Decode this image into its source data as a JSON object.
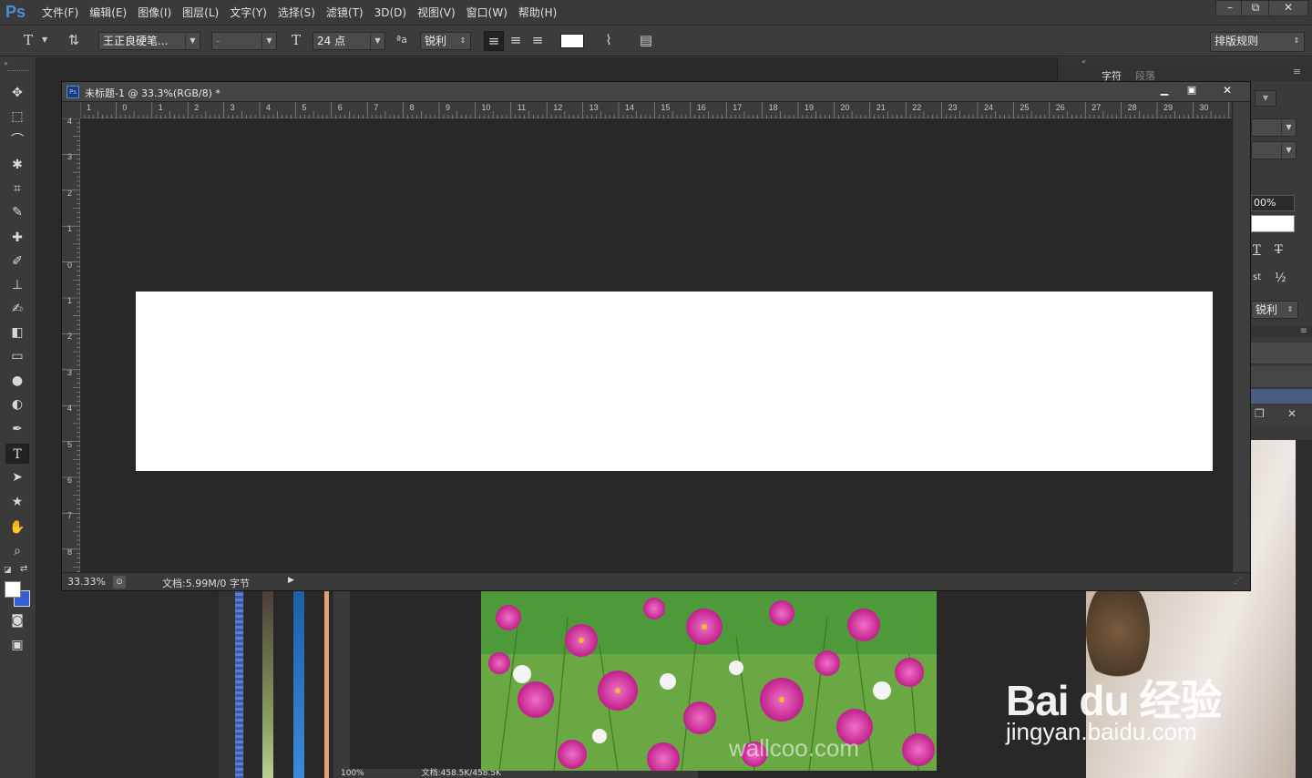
{
  "app": {
    "logo": "Ps"
  },
  "menu": [
    "文件(F)",
    "编辑(E)",
    "图像(I)",
    "图层(L)",
    "文字(Y)",
    "选择(S)",
    "滤镜(T)",
    "3D(D)",
    "视图(V)",
    "窗口(W)",
    "帮助(H)"
  ],
  "window_controls": {
    "minimize": "–",
    "restore": "⧉",
    "close": "✕"
  },
  "options_bar": {
    "tool_icon": "T",
    "font_family": "王正良硬笔...",
    "font_style": "-",
    "font_size": "24 点",
    "aa_label": "ªa",
    "antialias": "锐利",
    "color_swatch": "#ffffff",
    "workspace": "排版规则"
  },
  "right_panel": {
    "tabs": [
      "字符",
      "段落"
    ],
    "scale_value": "00%",
    "antialias": "锐利",
    "glyph_t": "T",
    "glyph_t2": "T",
    "glyph_st": "st",
    "glyph_half": "½"
  },
  "document": {
    "title": "未标题-1 @ 33.3%(RGB/8) *",
    "zoom": "33.33%",
    "doc_info": "文档:5.99M/0 字节",
    "ruler_top": [
      "1",
      "0",
      "1",
      "2",
      "3",
      "4",
      "5",
      "6",
      "7",
      "8",
      "9",
      "10",
      "11",
      "12",
      "13",
      "14",
      "15",
      "16",
      "17",
      "18",
      "19",
      "20",
      "21",
      "22",
      "23",
      "24",
      "25",
      "26",
      "27",
      "28",
      "29",
      "30"
    ],
    "ruler_left": [
      "4",
      "3",
      "2",
      "1",
      "0",
      "1",
      "2",
      "3",
      "4",
      "5",
      "6",
      "7",
      "8"
    ]
  },
  "background_doc": {
    "zoom": "100%",
    "doc_info": "文档:458.5K/458.5K"
  },
  "watermark": {
    "brand": "Bai du 经验",
    "url": "jingyan.baidu.com",
    "image_credit": "wallcoo.com"
  },
  "colors": {
    "foreground": "#ffffff",
    "background": "#2f5fd0"
  }
}
